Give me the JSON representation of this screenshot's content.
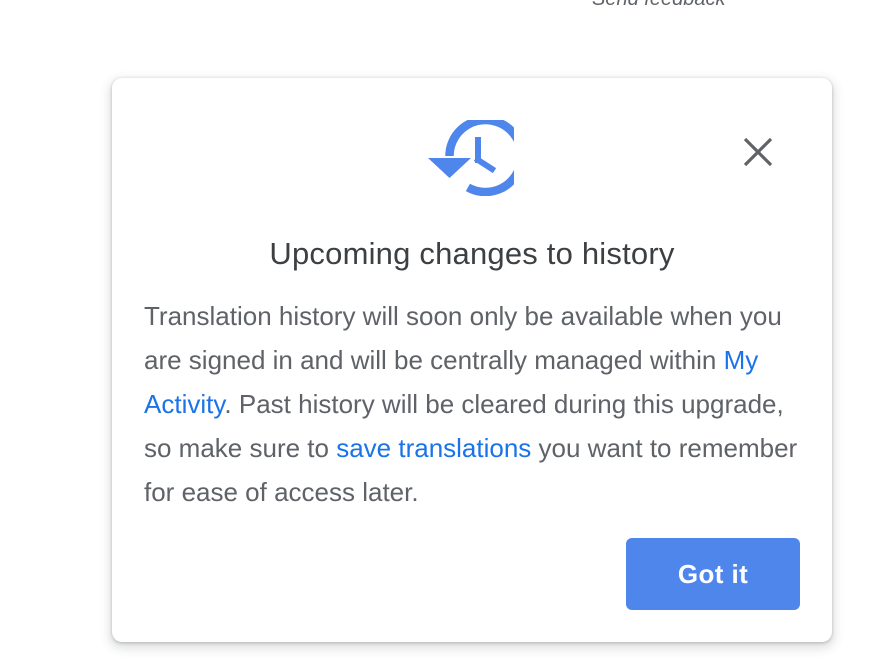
{
  "header": {
    "send_feedback_label": "Send feedback"
  },
  "dialog": {
    "icon": "history-icon",
    "close_icon": "close-icon",
    "title": "Upcoming changes to history",
    "body": {
      "part1": "Translation history will soon only be available when you are signed in and will be centrally managed within ",
      "link1": "My Activity",
      "part2": ". Past history will be cleared during this upgrade, so make sure to ",
      "link2": "save translations",
      "part3": " you want to remember for ease of access later."
    },
    "confirm_label": "Got it"
  },
  "colors": {
    "accent": "#4f86ec",
    "link": "#1a73e8",
    "title_text": "#3c4043",
    "body_text": "#5f6368",
    "close_icon": "#5f6368"
  }
}
